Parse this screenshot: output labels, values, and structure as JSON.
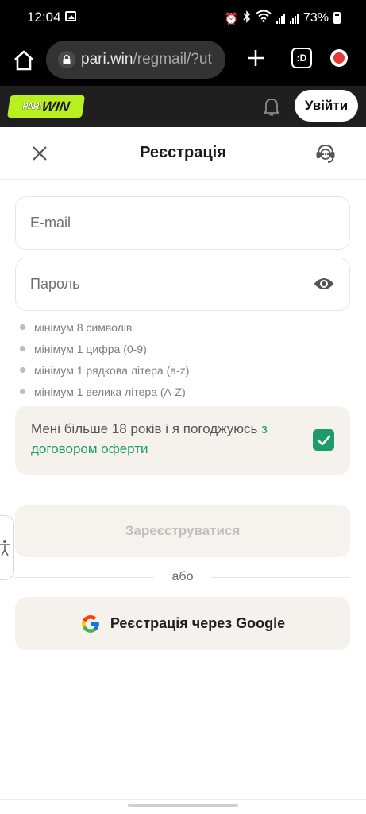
{
  "status_bar": {
    "time": "12:04",
    "battery": "73%",
    "icons": [
      "gallery-icon",
      "alarm-icon",
      "bluetooth-icon",
      "wifi-icon",
      "signal-icon",
      "signal-icon",
      "battery-icon"
    ]
  },
  "browser": {
    "url_domain": "pari.win",
    "url_path": "/regmail/?ut",
    "tabs_label": ":D"
  },
  "header": {
    "logo_pari": "PARI",
    "logo_win": "WIN",
    "login_label": "Увійти",
    "brand_color": "#b8ef1e"
  },
  "registration": {
    "title": "Реєстрація",
    "email_placeholder": "E-mail",
    "password_placeholder": "Пароль",
    "requirements": [
      "мінімум 8 символів",
      "мінімум 1 цифра (0-9)",
      "мінімум 1 рядкова літера (a-z)",
      "мінімум 1 велика літера (A-Z)"
    ],
    "agree_text": "Мені більше 18 років і я погоджуюсь ",
    "agree_link": "з договором оферти",
    "agree_checked": true,
    "submit_label": "Зареєструватися",
    "or_label": "або",
    "google_label": "Реєстрація через Google",
    "accent_color": "#1d9b6c"
  }
}
